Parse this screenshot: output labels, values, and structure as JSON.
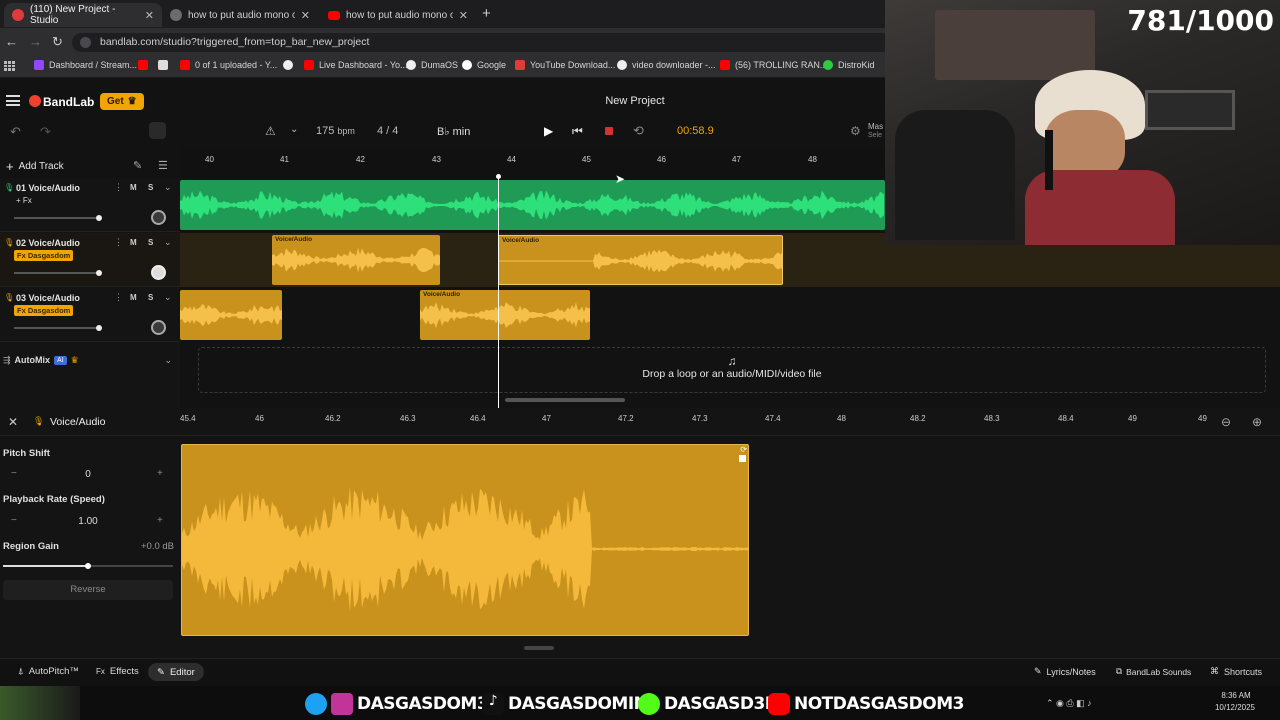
{
  "browser": {
    "tabs": [
      {
        "label": "(110) New Project - Studio"
      },
      {
        "label": "how to put audio mono on ban"
      },
      {
        "label": "how to put audio mono on ban"
      }
    ],
    "new_tab": "+",
    "url": "bandlab.com/studio?triggered_from=top_bar_new_project",
    "bookmarks": [
      {
        "label": "Dashboard / Stream..."
      },
      {
        "label": "0 of 1 uploaded - Y..."
      },
      {
        "label": "Live Dashboard - Yo..."
      },
      {
        "label": "DumaOS"
      },
      {
        "label": "Google"
      },
      {
        "label": "YouTube Download..."
      },
      {
        "label": "video downloader -..."
      },
      {
        "label": "(56) TROLLING RAN..."
      },
      {
        "label": "DistroKid"
      }
    ]
  },
  "app": {
    "brand": "BandLab",
    "get_label": "Get",
    "project_title": "New Project",
    "bpm": "175",
    "bpm_unit": "bpm",
    "time_signature": "4 / 4",
    "key": "B♭ min",
    "time": "00:58.9",
    "master_label": "Mas",
    "select_label": "Sele"
  },
  "tracks_header": {
    "add_track": "Add Track"
  },
  "tracks": [
    {
      "name": "01 Voice/Audio",
      "fx": "+ Fx",
      "m": "M",
      "s": "S"
    },
    {
      "name": "02 Voice/Audio",
      "fx": "Fx Dasgasdom",
      "m": "M",
      "s": "S"
    },
    {
      "name": "03 Voice/Audio",
      "fx": "Fx Dasgasdom",
      "m": "M",
      "s": "S"
    }
  ],
  "automix": {
    "label": "AutoMix",
    "badge": "AI"
  },
  "timeline": {
    "ticks": [
      "40",
      "41",
      "42",
      "43",
      "44",
      "45",
      "46",
      "47",
      "48"
    ]
  },
  "regions": {
    "label": "Voice/Audio"
  },
  "drop_text": "Drop a loop or an audio/MIDI/video file",
  "editor": {
    "title": "Voice/Audio",
    "ruler": [
      "45.4",
      "46",
      "46.2",
      "46.3",
      "46.4",
      "47",
      "47.2",
      "47.3",
      "47.4",
      "48",
      "48.2",
      "48.3",
      "48.4",
      "49",
      "49"
    ],
    "pitch_shift_label": "Pitch Shift",
    "pitch_shift_value": "0",
    "playback_rate_label": "Playback Rate (Speed)",
    "playback_rate_value": "1.00",
    "region_gain_label": "Region Gain",
    "region_gain_value": "+0.0 dB",
    "reverse_label": "Reverse",
    "minus": "−",
    "plus": "+"
  },
  "bottom": {
    "autopitch": "AutoPitch™",
    "effects": "Effects",
    "editor": "Editor",
    "lyrics": "Lyrics/Notes",
    "sounds": "BandLab Sounds",
    "shortcuts": "Shortcuts"
  },
  "stream": {
    "counter": "781/1000",
    "socials": [
      {
        "handle": "DASGASDOM3",
        "color": "#1da1f2"
      },
      {
        "handle": "DASGASDOMINI",
        "color": "#111111"
      },
      {
        "handle": "DASGASD3M",
        "color": "#53fc18"
      },
      {
        "handle": "NOTDASGASDOM3",
        "color": "#ff0000"
      }
    ],
    "clock": "8:36 AM",
    "date": "10/12/2025"
  }
}
